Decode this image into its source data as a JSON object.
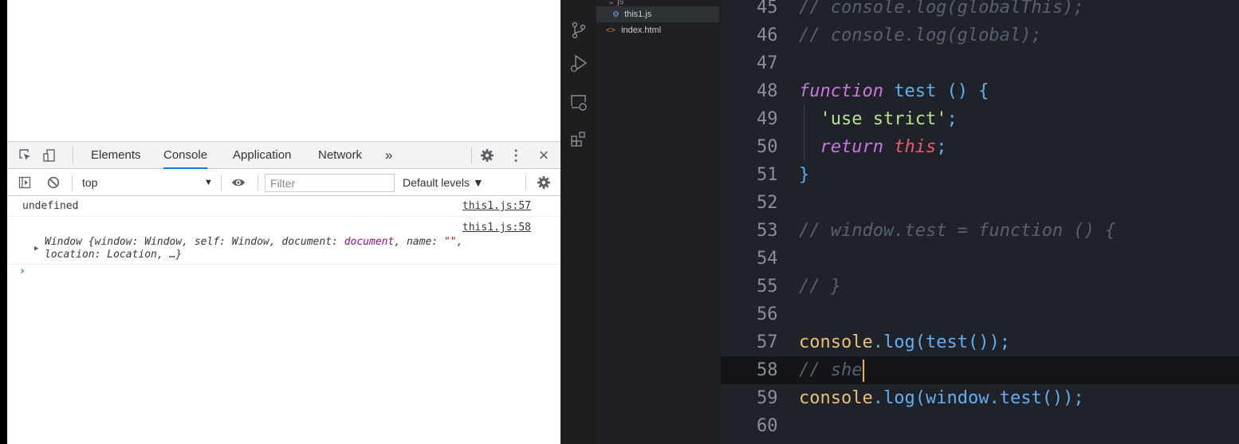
{
  "devtools": {
    "tabs": [
      {
        "label": "Elements"
      },
      {
        "label": "Console"
      },
      {
        "label": "Application"
      },
      {
        "label": "Network"
      }
    ],
    "more_tabs": "»",
    "kebab": "⋮",
    "close": "×",
    "toolbar": {
      "context": "top",
      "context_caret": "▼",
      "filter_placeholder": "Filter",
      "levels": "Default levels ▼"
    },
    "messages": [
      {
        "text": "undefined",
        "source": "this1.js:57"
      },
      {
        "source": "this1.js:58",
        "obj_prefix": "Window {window: Window, self: Window, document: ",
        "obj_doc": "document",
        "obj_mid": ", name: ",
        "obj_str": "\"\"",
        "obj_end": ",",
        "obj_line2": "location: Location, …}"
      }
    ],
    "prompt": "›"
  },
  "explorer": {
    "items": [
      {
        "label": "this1.js",
        "icon": "⚙"
      },
      {
        "label": "index.html",
        "icon": "<>"
      }
    ]
  },
  "editor": {
    "lines": [
      {
        "num": "45",
        "tokens": [
          {
            "t": "// console.log(globalThis);",
            "c": "comment"
          }
        ]
      },
      {
        "num": "46",
        "tokens": [
          {
            "t": "// console.log(global);",
            "c": "comment"
          }
        ]
      },
      {
        "num": "47",
        "tokens": []
      },
      {
        "num": "48",
        "tokens": [
          {
            "t": "function",
            "c": "keyword"
          },
          {
            "t": " ",
            "c": "punct"
          },
          {
            "t": "test",
            "c": "func"
          },
          {
            "t": " () {",
            "c": "paren"
          }
        ]
      },
      {
        "num": "49",
        "tokens": [
          {
            "t": "  ",
            "c": "punct"
          },
          {
            "t": "'use strict'",
            "c": "string"
          },
          {
            "t": ";",
            "c": "paren"
          }
        ]
      },
      {
        "num": "50",
        "tokens": [
          {
            "t": "  ",
            "c": "punct"
          },
          {
            "t": "return",
            "c": "keyword"
          },
          {
            "t": " ",
            "c": "punct"
          },
          {
            "t": "this",
            "c": "this"
          },
          {
            "t": ";",
            "c": "paren"
          }
        ]
      },
      {
        "num": "51",
        "tokens": [
          {
            "t": "}",
            "c": "paren"
          }
        ]
      },
      {
        "num": "52",
        "tokens": []
      },
      {
        "num": "53",
        "tokens": [
          {
            "t": "// window.test = function () {",
            "c": "comment"
          }
        ]
      },
      {
        "num": "54",
        "tokens": []
      },
      {
        "num": "55",
        "tokens": [
          {
            "t": "// }",
            "c": "comment"
          }
        ]
      },
      {
        "num": "56",
        "tokens": []
      },
      {
        "num": "57",
        "tokens": [
          {
            "t": "console",
            "c": "var"
          },
          {
            "t": ".",
            "c": "dot"
          },
          {
            "t": "log",
            "c": "func"
          },
          {
            "t": "(",
            "c": "paren"
          },
          {
            "t": "test",
            "c": "func"
          },
          {
            "t": "());",
            "c": "paren"
          }
        ]
      },
      {
        "num": "58",
        "tokens": [
          {
            "t": "// she",
            "c": "comment"
          }
        ],
        "current": true
      },
      {
        "num": "59",
        "tokens": [
          {
            "t": "console",
            "c": "var"
          },
          {
            "t": ".",
            "c": "dot"
          },
          {
            "t": "log",
            "c": "func"
          },
          {
            "t": "(",
            "c": "paren"
          },
          {
            "t": "window",
            "c": "func"
          },
          {
            "t": ".",
            "c": "dot"
          },
          {
            "t": "test",
            "c": "func"
          },
          {
            "t": "());",
            "c": "paren"
          }
        ]
      },
      {
        "num": "60",
        "tokens": []
      }
    ]
  }
}
